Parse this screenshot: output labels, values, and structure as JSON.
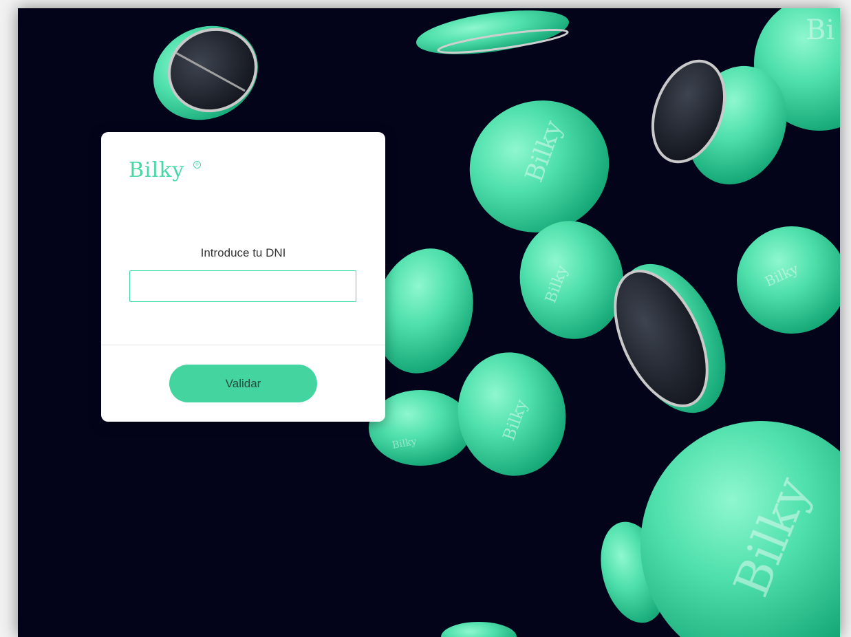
{
  "brand": {
    "logo_text": "Bilky",
    "logo_mark": "®",
    "accent_color": "#46d8a4",
    "background_color": "#03041a"
  },
  "login": {
    "label": "Introduce tu DNI",
    "input_value": "",
    "input_placeholder": "",
    "submit_label": "Validar"
  },
  "background_art": {
    "description_icon": "floating-bilky-pills"
  }
}
